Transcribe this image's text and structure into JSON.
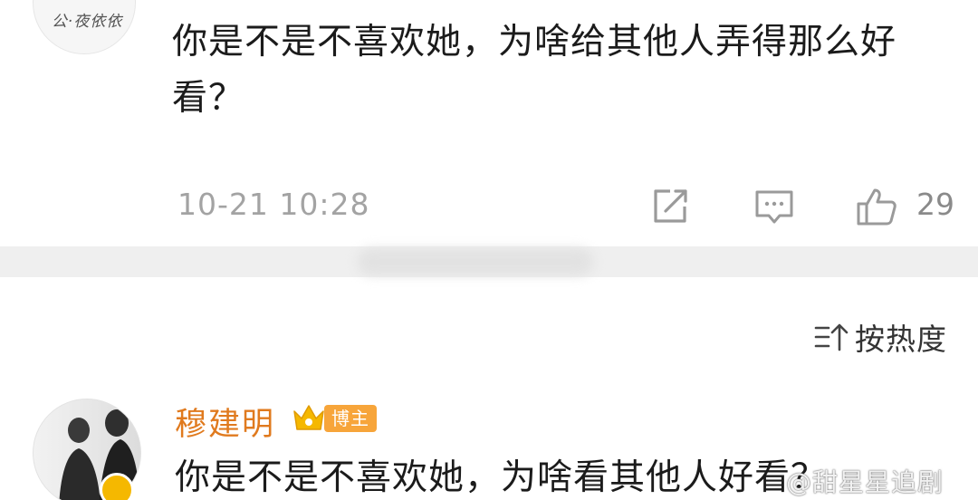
{
  "first_comment": {
    "avatar_text": "公·夜依依",
    "text": "你是不是不喜欢她，为啥给其他人弄得那么好看？",
    "timestamp": "10-21 10:28",
    "like_count": "29"
  },
  "sort": {
    "label": "按热度"
  },
  "second_comment": {
    "username": "穆建明",
    "author_tag": "博主",
    "text": "你是不是不喜欢她，为啥看其他人好看？"
  },
  "watermark": "@甜星星追剧",
  "colors": {
    "username": "#e07a1e",
    "author_tag_bg": "#f7a53a",
    "badge": "#f5b800",
    "meta_text": "#a3a3a3"
  },
  "icons": {
    "share": "share-icon",
    "comment": "comment-icon",
    "like": "thumbs-up-icon",
    "sort": "sort-icon",
    "crown": "crown-icon",
    "verified": "verified-badge-icon"
  }
}
